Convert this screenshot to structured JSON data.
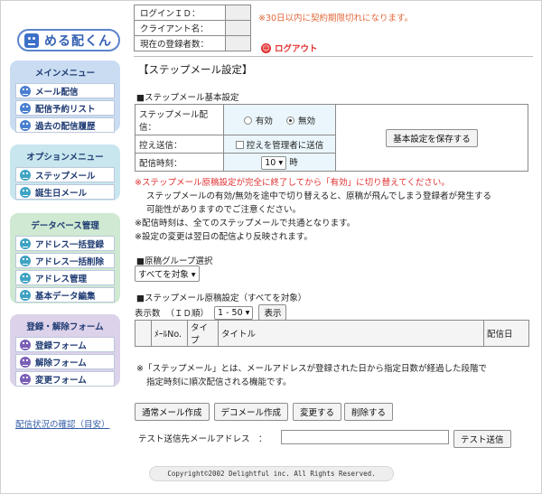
{
  "header": {
    "login_id_label": "ログインＩＤ：",
    "client_label": "クライアント名：",
    "registered_count_label": "現在の登録者数：",
    "expire_warning": "※30日以内に契約期限切れになります。",
    "logout_label": "ログアウト"
  },
  "logo": {
    "text": "める配くん"
  },
  "sidebar": {
    "main_menu": {
      "title": "メインメニュー",
      "items": [
        "メール配信",
        "配信予約リスト",
        "過去の配信履歴"
      ]
    },
    "option_menu": {
      "title": "オプションメニュー",
      "items": [
        "ステップメール",
        "誕生日メール"
      ]
    },
    "database_menu": {
      "title": "データベース管理",
      "items": [
        "アドレス一括登録",
        "アドレス一括削除",
        "アドレス管理",
        "基本データ編集"
      ]
    },
    "registration_menu": {
      "title": "登録・解除フォーム",
      "items": [
        "登録フォーム",
        "解除フォーム",
        "変更フォーム"
      ]
    },
    "status_link": "配信状況の確認（目安）"
  },
  "main": {
    "page_title": "【ステップメール設定】",
    "basic_section_title": "■ステップメール基本設定",
    "basic": {
      "step_label": "ステップメール配信：",
      "enabled_label": "有効",
      "disabled_label": "無効",
      "bcc_label": "控え送信：",
      "bcc_checkbox_label": "控えを管理者に送信",
      "time_label": "配信時刻：",
      "time_value": "10",
      "time_unit": "時",
      "save_button": "基本設定を保存する"
    },
    "notes": {
      "warning_line1": "※ステップメール原稿設定が完全に終了してから「有効」に切り替えてください。",
      "warning_line2": "ステップメールの有効/無効を途中で切り替えると、原稿が飛んでしまう登録者が発生する",
      "warning_line3": "可能性がありますのでご注意ください。",
      "common_time": "※配信時刻は、全てのステップメールで共通となります。",
      "next_day": "※設定の変更は翌日の配信より反映されます。"
    },
    "group_section_title": "■原稿グループ選択",
    "group_select_value": "すべてを対象",
    "source_section_title": "■ステップメール原稿設定（すべてを対象）",
    "display_label": "表示数",
    "id_order_label": "（ＩＤ順）",
    "range_value": "1 - 50",
    "display_button": "表示",
    "table_headers": [
      "",
      "ﾒｰﾙNo.",
      "タイプ",
      "タイトル",
      "配信日"
    ],
    "explain_line1": "※「ステップメール」とは、メールアドレスが登録された日から指定日数が経過した段階で",
    "explain_line2": "指定時刻に順次配信される機能です。",
    "buttons": {
      "create_normal": "通常メール作成",
      "create_deco": "デコメール作成",
      "change": "変更する",
      "delete": "削除する"
    },
    "test_send_label": "テスト送信先メールアドレス　：",
    "test_send_value": "",
    "test_send_button": "テスト送信"
  },
  "footer": {
    "copyright": "Copyright©2002 Delightful inc. All Rights Reserved."
  }
}
